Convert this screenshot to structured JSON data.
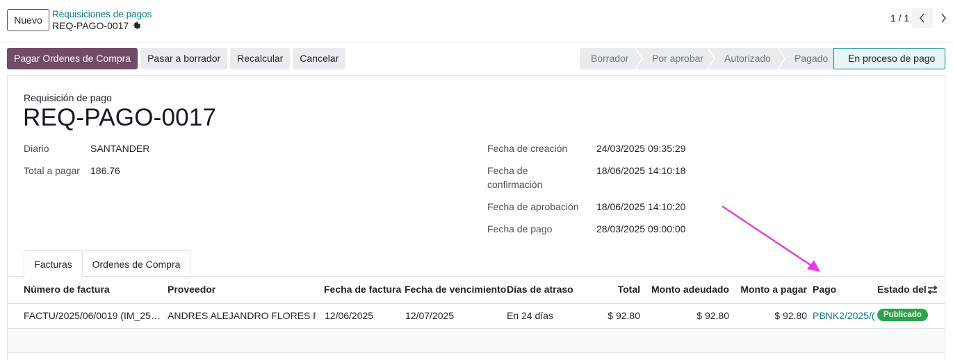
{
  "control_panel": {
    "new_button": "Nuevo",
    "breadcrumb_parent": "Requisiciones de pagos",
    "breadcrumb_current": "REQ-PAGO-0017",
    "pager": "1 / 1"
  },
  "actions": {
    "pay_orders": "Pagar Ordenes de Compra",
    "to_draft": "Pasar a borrador",
    "recalculate": "Recalcular",
    "cancel": "Cancelar"
  },
  "statusbar": {
    "states": [
      "Borrador",
      "Por aprobar",
      "Autorizado",
      "Pagado",
      "En proceso de pago"
    ],
    "active_state": "En proceso de pago"
  },
  "form": {
    "doc_label": "Requisición de pago",
    "doc_name": "REQ-PAGO-0017",
    "journal_label": "Diario",
    "journal_value": "SANTANDER",
    "total_label": "Total a pagar",
    "total_value": "186.76",
    "creation_label": "Fecha de creación",
    "creation_value": "24/03/2025 09:35:29",
    "confirmation_label_1": "Fecha de",
    "confirmation_label_2": "confirmación",
    "confirmation_value": "18/06/2025 14:10:18",
    "approval_label": "Fecha de aprobación",
    "approval_value": "18/06/2025 14:10:20",
    "payment_date_label": "Fecha de pago",
    "payment_date_value": "28/03/2025 09:00:00"
  },
  "tabs": [
    "Facturas",
    "Ordenes de Compra"
  ],
  "table": {
    "columns": [
      "Número de factura",
      "Proveedor",
      "Fecha de factura",
      "Fecha de vencimiento",
      "Días de atraso",
      "Total",
      "Monto adeudado",
      "Monto a pagar",
      "Pago",
      "Estado del"
    ],
    "rows": [
      {
        "invoice": "FACTU/2025/06/0019 (IM_25…",
        "vendor": "ANDRES ALEJANDRO FLORES R…",
        "invoice_date": "12/06/2025",
        "due_date": "12/07/2025",
        "overdue": "En 24 días",
        "total": "$ 92.80",
        "due_amount": "$ 92.80",
        "to_pay": "$ 92.80",
        "payment": "PBNK2/2025/(",
        "status": "Publicado"
      }
    ]
  },
  "colors": {
    "primary": "#714b67",
    "link": "#017e84",
    "badge_success": "#28a745",
    "annotation_arrow": "#e63de6"
  },
  "icons": [
    "gear-icon",
    "chevron-left-icon",
    "chevron-right-icon",
    "column-settings-icon"
  ]
}
